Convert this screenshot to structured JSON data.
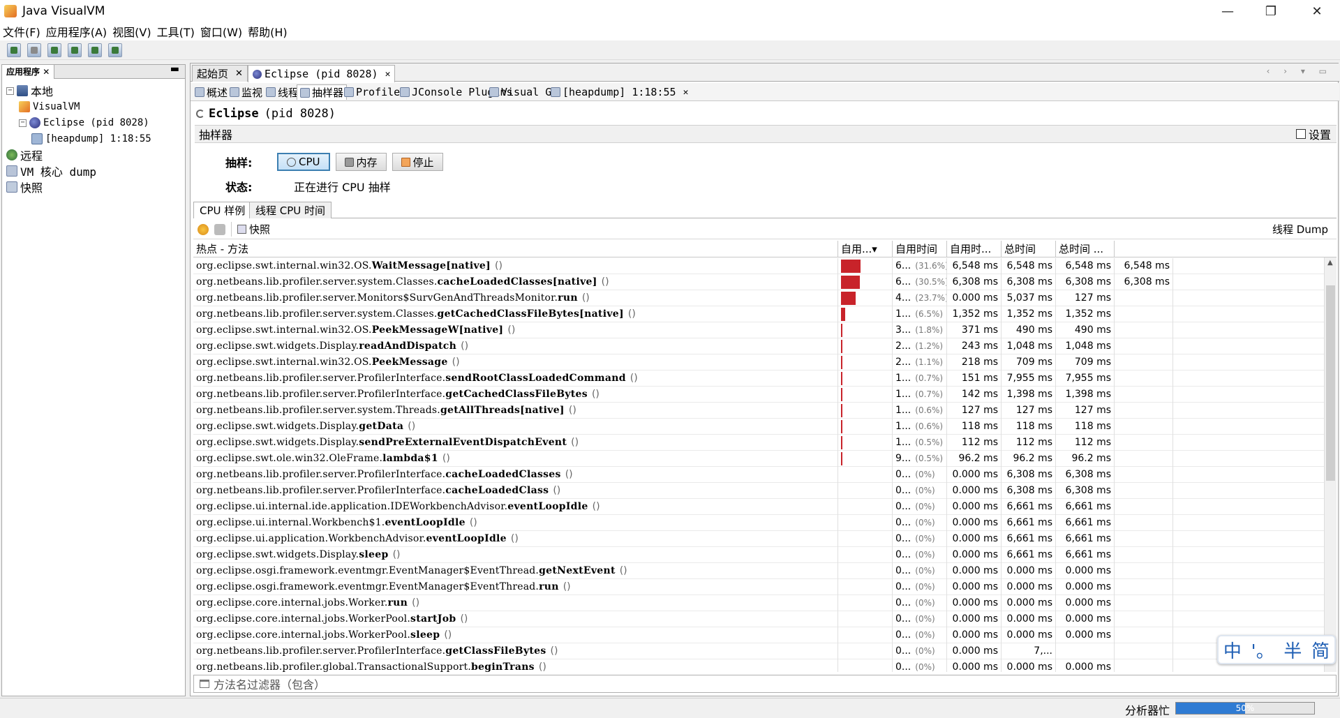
{
  "window": {
    "title": "Java VisualVM",
    "minimize": "—",
    "maximize": "❐",
    "close": "✕"
  },
  "menu": [
    "文件(F)",
    "应用程序(A)",
    "视图(V)",
    "工具(T)",
    "窗口(W)",
    "帮助(H)"
  ],
  "left_panel": {
    "tab": "应用程序",
    "tab_close": "✕",
    "minimize": "▬",
    "tree": [
      {
        "label": "本地",
        "icon": "computer-icon",
        "level": 0,
        "expander": "⊟"
      },
      {
        "label": "VisualVM",
        "icon": "visualvm-icon",
        "level": 1,
        "expander": ""
      },
      {
        "label": "Eclipse (pid 8028)",
        "icon": "eclipse-icon",
        "level": 1,
        "expander": "⊟"
      },
      {
        "label": "[heapdump] 1:18:55",
        "icon": "heapdump-icon",
        "level": 2,
        "expander": ""
      },
      {
        "label": "远程",
        "icon": "network-icon",
        "level": 0,
        "expander": ""
      },
      {
        "label": "VM 核心 dump",
        "icon": "core-dump-icon",
        "level": 0,
        "expander": ""
      },
      {
        "label": "快照",
        "icon": "snapshot-icon",
        "level": 0,
        "expander": ""
      }
    ]
  },
  "doc_tabs": [
    {
      "label": "起始页",
      "close": "✕"
    },
    {
      "label": "Eclipse (pid 8028)",
      "close": "✕"
    }
  ],
  "doc_nav": "‹ › ▾ ▭",
  "sub_tabs": [
    {
      "label": "概述"
    },
    {
      "label": "监视"
    },
    {
      "label": "线程"
    },
    {
      "label": "抽样器"
    },
    {
      "label": "Profiler"
    },
    {
      "label": "JConsole Plugins"
    },
    {
      "label": "Visual GC"
    },
    {
      "label": "[heapdump] 1:18:55",
      "close": "✕"
    }
  ],
  "app_title": {
    "name": "Eclipse",
    "pid": "(pid 8028)"
  },
  "section": {
    "title": "抽样器",
    "settings": "设置"
  },
  "sampler": {
    "label": "抽样:",
    "cpu": "CPU",
    "memory": "内存",
    "stop": "停止",
    "status_label": "状态:",
    "status_value": "正在进行 CPU 抽样"
  },
  "view_tabs": [
    "CPU 样例",
    "线程 CPU 时间"
  ],
  "results_toolbar": {
    "snapshot": "快照",
    "thread_dump": "线程 Dump"
  },
  "table": {
    "columns": [
      "热点 - 方法",
      "自用...▾",
      "自用时间",
      "自用时...",
      "总时间",
      "总时间 ..."
    ],
    "rows": [
      {
        "pkg": "org.eclipse.swt.internal.win32.OS.",
        "meth": "WaitMessage[native]",
        "self_pct": 31.6,
        "self": "6...",
        "pct": "(31.6%)",
        "self_time": "6,548 ms",
        "self_cpu": "6,548 ms",
        "total": "6,548 ms",
        "total_cpu": "6,548 ms"
      },
      {
        "pkg": "org.netbeans.lib.profiler.server.system.Classes.",
        "meth": "cacheLoadedClasses[native]",
        "self_pct": 30.5,
        "self": "6...",
        "pct": "(30.5%)",
        "self_time": "6,308 ms",
        "self_cpu": "6,308 ms",
        "total": "6,308 ms",
        "total_cpu": "6,308 ms"
      },
      {
        "pkg": "org.netbeans.lib.profiler.server.Monitors$SurvGenAndThreadsMonitor.",
        "meth": "run",
        "self_pct": 23.7,
        "self": "4...",
        "pct": "(23.7%)",
        "self_time": "0.000 ms",
        "self_cpu": "5,037 ms",
        "total": "127 ms",
        "total_cpu": ""
      },
      {
        "pkg": "org.netbeans.lib.profiler.server.system.Classes.",
        "meth": "getCachedClassFileBytes[native]",
        "self_pct": 6.5,
        "self": "1...",
        "pct": "(6.5%)",
        "self_time": "1,352 ms",
        "self_cpu": "1,352 ms",
        "total": "1,352 ms",
        "total_cpu": ""
      },
      {
        "pkg": "org.eclipse.swt.internal.win32.OS.",
        "meth": "PeekMessageW[native]",
        "self_pct": 1.8,
        "self": "3...",
        "pct": "(1.8%)",
        "self_time": "371 ms",
        "self_cpu": "490 ms",
        "total": "490 ms",
        "total_cpu": ""
      },
      {
        "pkg": "org.eclipse.swt.widgets.Display.",
        "meth": "readAndDispatch",
        "self_pct": 1.2,
        "self": "2...",
        "pct": "(1.2%)",
        "self_time": "243 ms",
        "self_cpu": "1,048 ms",
        "total": "1,048 ms",
        "total_cpu": ""
      },
      {
        "pkg": "org.eclipse.swt.internal.win32.OS.",
        "meth": "PeekMessage",
        "self_pct": 1.1,
        "self": "2...",
        "pct": "(1.1%)",
        "self_time": "218 ms",
        "self_cpu": "709 ms",
        "total": "709 ms",
        "total_cpu": ""
      },
      {
        "pkg": "org.netbeans.lib.profiler.server.ProfilerInterface.",
        "meth": "sendRootClassLoadedCommand",
        "self_pct": 0.7,
        "self": "1...",
        "pct": "(0.7%)",
        "self_time": "151 ms",
        "self_cpu": "7,955 ms",
        "total": "7,955 ms",
        "total_cpu": ""
      },
      {
        "pkg": "org.netbeans.lib.profiler.server.ProfilerInterface.",
        "meth": "getCachedClassFileBytes",
        "self_pct": 0.7,
        "self": "1...",
        "pct": "(0.7%)",
        "self_time": "142 ms",
        "self_cpu": "1,398 ms",
        "total": "1,398 ms",
        "total_cpu": ""
      },
      {
        "pkg": "org.netbeans.lib.profiler.server.system.Threads.",
        "meth": "getAllThreads[native]",
        "self_pct": 0.6,
        "self": "1...",
        "pct": "(0.6%)",
        "self_time": "127 ms",
        "self_cpu": "127 ms",
        "total": "127 ms",
        "total_cpu": ""
      },
      {
        "pkg": "org.eclipse.swt.widgets.Display.",
        "meth": "getData",
        "self_pct": 0.6,
        "self": "1...",
        "pct": "(0.6%)",
        "self_time": "118 ms",
        "self_cpu": "118 ms",
        "total": "118 ms",
        "total_cpu": ""
      },
      {
        "pkg": "org.eclipse.swt.widgets.Display.",
        "meth": "sendPreExternalEventDispatchEvent",
        "self_pct": 0.5,
        "self": "1...",
        "pct": "(0.5%)",
        "self_time": "112 ms",
        "self_cpu": "112 ms",
        "total": "112 ms",
        "total_cpu": ""
      },
      {
        "pkg": "org.eclipse.swt.ole.win32.OleFrame.",
        "meth": "lambda$1",
        "self_pct": 0.5,
        "self": "9...",
        "pct": "(0.5%)",
        "self_time": "96.2 ms",
        "self_cpu": "96.2 ms",
        "total": "96.2 ms",
        "total_cpu": ""
      },
      {
        "pkg": "org.netbeans.lib.profiler.server.ProfilerInterface.",
        "meth": "cacheLoadedClasses",
        "self_pct": 0,
        "self": "0...",
        "pct": "(0%)",
        "self_time": "0.000 ms",
        "self_cpu": "6,308 ms",
        "total": "6,308 ms",
        "total_cpu": ""
      },
      {
        "pkg": "org.netbeans.lib.profiler.server.ProfilerInterface.",
        "meth": "cacheLoadedClass",
        "self_pct": 0,
        "self": "0...",
        "pct": "(0%)",
        "self_time": "0.000 ms",
        "self_cpu": "6,308 ms",
        "total": "6,308 ms",
        "total_cpu": ""
      },
      {
        "pkg": "org.eclipse.ui.internal.ide.application.IDEWorkbenchAdvisor.",
        "meth": "eventLoopIdle",
        "self_pct": 0,
        "self": "0...",
        "pct": "(0%)",
        "self_time": "0.000 ms",
        "self_cpu": "6,661 ms",
        "total": "6,661 ms",
        "total_cpu": ""
      },
      {
        "pkg": "org.eclipse.ui.internal.Workbench$1.",
        "meth": "eventLoopIdle",
        "self_pct": 0,
        "self": "0...",
        "pct": "(0%)",
        "self_time": "0.000 ms",
        "self_cpu": "6,661 ms",
        "total": "6,661 ms",
        "total_cpu": ""
      },
      {
        "pkg": "org.eclipse.ui.application.WorkbenchAdvisor.",
        "meth": "eventLoopIdle",
        "self_pct": 0,
        "self": "0...",
        "pct": "(0%)",
        "self_time": "0.000 ms",
        "self_cpu": "6,661 ms",
        "total": "6,661 ms",
        "total_cpu": ""
      },
      {
        "pkg": "org.eclipse.swt.widgets.Display.",
        "meth": "sleep",
        "self_pct": 0,
        "self": "0...",
        "pct": "(0%)",
        "self_time": "0.000 ms",
        "self_cpu": "6,661 ms",
        "total": "6,661 ms",
        "total_cpu": ""
      },
      {
        "pkg": "org.eclipse.osgi.framework.eventmgr.EventManager$EventThread.",
        "meth": "getNextEvent",
        "self_pct": 0,
        "self": "0...",
        "pct": "(0%)",
        "self_time": "0.000 ms",
        "self_cpu": "0.000 ms",
        "total": "0.000 ms",
        "total_cpu": ""
      },
      {
        "pkg": "org.eclipse.osgi.framework.eventmgr.EventManager$EventThread.",
        "meth": "run",
        "self_pct": 0,
        "self": "0...",
        "pct": "(0%)",
        "self_time": "0.000 ms",
        "self_cpu": "0.000 ms",
        "total": "0.000 ms",
        "total_cpu": ""
      },
      {
        "pkg": "org.eclipse.core.internal.jobs.Worker.",
        "meth": "run",
        "self_pct": 0,
        "self": "0...",
        "pct": "(0%)",
        "self_time": "0.000 ms",
        "self_cpu": "0.000 ms",
        "total": "0.000 ms",
        "total_cpu": ""
      },
      {
        "pkg": "org.eclipse.core.internal.jobs.WorkerPool.",
        "meth": "startJob",
        "self_pct": 0,
        "self": "0...",
        "pct": "(0%)",
        "self_time": "0.000 ms",
        "self_cpu": "0.000 ms",
        "total": "0.000 ms",
        "total_cpu": ""
      },
      {
        "pkg": "org.eclipse.core.internal.jobs.WorkerPool.",
        "meth": "sleep",
        "self_pct": 0,
        "self": "0...",
        "pct": "(0%)",
        "self_time": "0.000 ms",
        "self_cpu": "0.000 ms",
        "total": "0.000 ms",
        "total_cpu": ""
      },
      {
        "pkg": "org.netbeans.lib.profiler.server.ProfilerInterface.",
        "meth": "getClassFileBytes",
        "self_pct": 0,
        "self": "0...",
        "pct": "(0%)",
        "self_time": "0.000 ms",
        "self_cpu": "7,...",
        "total": "",
        "total_cpu": ""
      },
      {
        "pkg": "org.netbeans.lib.profiler.global.TransactionalSupport.",
        "meth": "beginTrans",
        "self_pct": 0,
        "self": "0...",
        "pct": "(0%)",
        "self_time": "0.000 ms",
        "self_cpu": "0.000 ms",
        "total": "0.000 ms",
        "total_cpu": ""
      }
    ]
  },
  "filter": {
    "placeholder": "方法名过滤器（包含）"
  },
  "status_bar": {
    "label": "分析器忙",
    "progress": 50,
    "progress_label": "50%"
  },
  "ime": [
    "中",
    "'。",
    "半",
    "简"
  ]
}
